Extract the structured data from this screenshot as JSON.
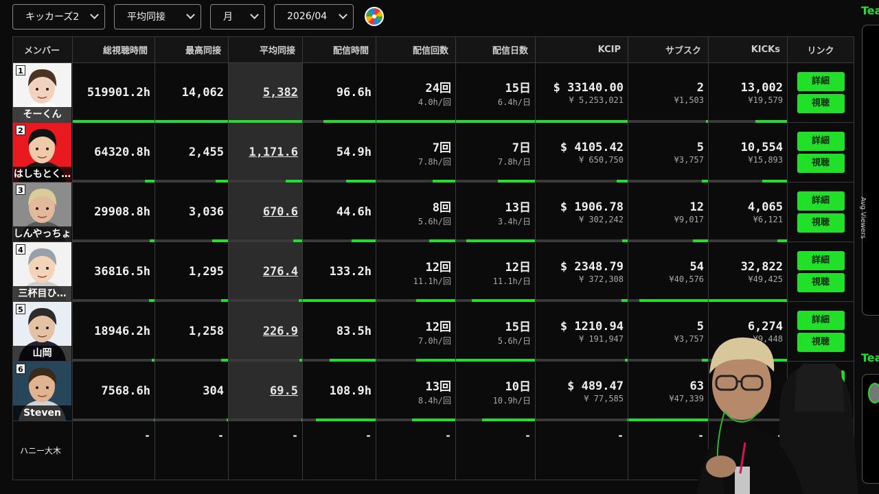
{
  "filters": {
    "group": "キッカーズ2",
    "metric": "平均同接",
    "period": "月",
    "month": "2026/04"
  },
  "headers": [
    "メンバー",
    "総視聴時間",
    "最高同接",
    "平均同接",
    "配信時間",
    "配信回数",
    "配信日数",
    "KCIP",
    "サブスク",
    "KICKs",
    "リンク"
  ],
  "buttons": {
    "detail": "詳細",
    "watch": "視聴"
  },
  "rows": [
    {
      "rank": "1",
      "name": "そーくん",
      "total": "519901.2h",
      "peak": "14,062",
      "avg": "5,382",
      "hours": "96.6h",
      "count": "24回",
      "count_sub": "4.0h/回",
      "days": "15日",
      "days_sub": "6.4h/日",
      "kcip": "$ 33140.00",
      "kcip_sub": "¥ 5,253,021",
      "subs": "2",
      "subs_sub": "¥1,503",
      "kicks": "13,002",
      "kicks_sub": "¥19,579",
      "bars": [
        1.0,
        1.0,
        1.0,
        0.72,
        1.0,
        1.0,
        1.0,
        0.03,
        0.4
      ]
    },
    {
      "rank": "2",
      "name": "はしもとく…",
      "total": "64320.8h",
      "peak": "2,455",
      "avg": "1,171.6",
      "hours": "54.9h",
      "count": "7回",
      "count_sub": "7.8h/回",
      "days": "7日",
      "days_sub": "7.8h/日",
      "kcip": "$ 4105.42",
      "kcip_sub": "¥ 650,750",
      "subs": "5",
      "subs_sub": "¥3,757",
      "kicks": "10,554",
      "kicks_sub": "¥15,893",
      "bars": [
        0.12,
        0.17,
        0.22,
        0.41,
        0.29,
        0.47,
        0.12,
        0.08,
        0.32
      ]
    },
    {
      "rank": "3",
      "name": "しんやっちょ",
      "total": "29908.8h",
      "peak": "3,036",
      "avg": "670.6",
      "hours": "44.6h",
      "count": "8回",
      "count_sub": "5.6h/回",
      "days": "13日",
      "days_sub": "3.4h/日",
      "kcip": "$ 1906.78",
      "kcip_sub": "¥ 302,242",
      "subs": "12",
      "subs_sub": "¥9,017",
      "kicks": "4,065",
      "kicks_sub": "¥6,121",
      "bars": [
        0.06,
        0.22,
        0.12,
        0.33,
        0.33,
        0.87,
        0.06,
        0.19,
        0.12
      ]
    },
    {
      "rank": "4",
      "name": "三杯目ひ…",
      "total": "36816.5h",
      "peak": "1,295",
      "avg": "276.4",
      "hours": "133.2h",
      "count": "12回",
      "count_sub": "11.1h/回",
      "days": "12日",
      "days_sub": "11.1h/日",
      "kcip": "$ 2348.79",
      "kcip_sub": "¥ 372,308",
      "subs": "54",
      "subs_sub": "¥40,576",
      "kicks": "32,822",
      "kicks_sub": "¥49,425",
      "bars": [
        0.07,
        0.09,
        0.05,
        1.0,
        0.5,
        0.8,
        0.07,
        0.86,
        1.0
      ]
    },
    {
      "rank": "5",
      "name": "山岡",
      "total": "18946.2h",
      "peak": "1,258",
      "avg": "226.9",
      "hours": "83.5h",
      "count": "12回",
      "count_sub": "7.0h/回",
      "days": "15日",
      "days_sub": "5.6h/日",
      "kcip": "$ 1210.94",
      "kcip_sub": "¥ 191,947",
      "subs": "5",
      "subs_sub": "¥3,757",
      "kicks": "6,274",
      "kicks_sub": "¥9,448",
      "bars": [
        0.03,
        0.09,
        0.04,
        0.63,
        0.5,
        1.0,
        0.03,
        0.08,
        0.19
      ]
    },
    {
      "rank": "6",
      "name": "Steven",
      "total": "7568.6h",
      "peak": "304",
      "avg": "69.5",
      "hours": "108.9h",
      "count": "13回",
      "count_sub": "8.4h/回",
      "days": "10日",
      "days_sub": "10.9h/日",
      "kcip": "$ 489.47",
      "kcip_sub": "¥ 77,585",
      "subs": "63",
      "subs_sub": "¥47,339",
      "kicks": "",
      "kicks_sub": "",
      "bars": [
        0.01,
        0.02,
        0.01,
        0.82,
        0.55,
        0.67,
        0.01,
        1.0,
        0.0
      ]
    }
  ],
  "empty_row": {
    "name": "ハニー大木",
    "dash": "-"
  },
  "side": {
    "team_label_1": "Tea",
    "team_label_2": "Tea",
    "vertical_label": "Avg Viewers"
  },
  "colors": {
    "accent": "#22e02a",
    "background": "#0b0b0b",
    "avg_column": "#2c2c2c"
  }
}
